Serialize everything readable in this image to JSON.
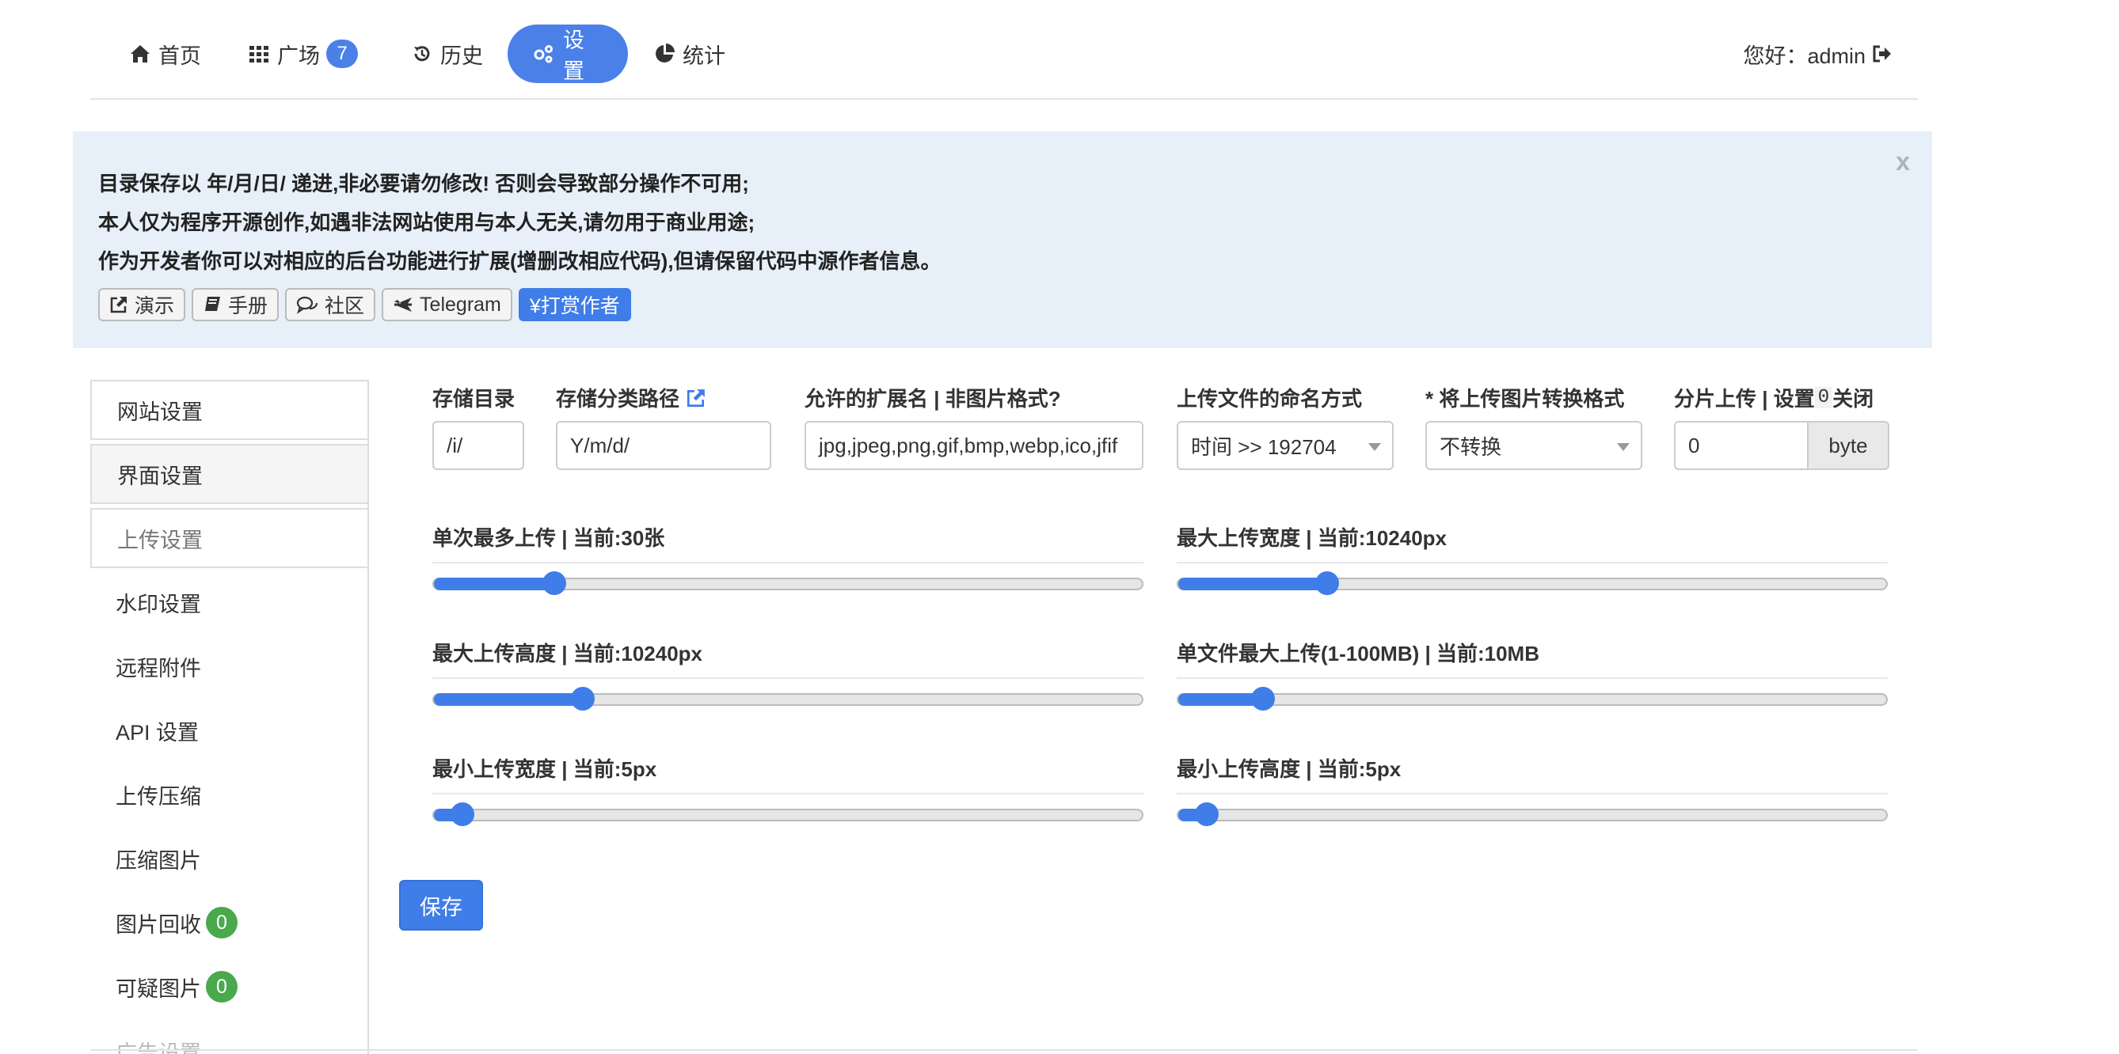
{
  "nav": {
    "home": "首页",
    "square": "广场",
    "square_badge": "7",
    "history": "历史",
    "settings": "设置",
    "stats": "统计",
    "greeting": "您好：admin"
  },
  "notice": {
    "close": "x",
    "line1": "目录保存以 年/月/日/ 递进,非必要请勿修改! 否则会导致部分操作不可用;",
    "line2": "本人仅为程序开源创作,如遇非法网站使用与本人无关,请勿用于商业用途;",
    "line3": "作为开发者你可以对相应的后台功能进行扩展(增删改相应代码),但请保留代码中源作者信息。",
    "buttons": {
      "demo": "演示",
      "manual": "手册",
      "community": "社区",
      "telegram": "Telegram",
      "donate": "¥打赏作者"
    }
  },
  "sidebar": {
    "items": [
      {
        "label": "网站设置"
      },
      {
        "label": "界面设置"
      },
      {
        "label": "上传设置"
      },
      {
        "label": "水印设置"
      },
      {
        "label": "远程附件"
      },
      {
        "label": "API 设置"
      },
      {
        "label": "上传压缩"
      },
      {
        "label": "压缩图片"
      },
      {
        "label": "图片回收",
        "badge": "0"
      },
      {
        "label": "可疑图片",
        "badge": "0"
      },
      {
        "label": "广告设置"
      }
    ]
  },
  "form": {
    "storage_dir": {
      "label": "存储目录",
      "value": "/i/"
    },
    "storage_path": {
      "label": "存储分类路径",
      "value": "Y/m/d/"
    },
    "extensions": {
      "label": "允许的扩展名 | 非图片格式?",
      "value": "jpg,jpeg,png,gif,bmp,webp,ico,jfif"
    },
    "naming": {
      "label": "上传文件的命名方式",
      "value": "时间 >> 192704"
    },
    "convert": {
      "label": "* 将上传图片转换格式",
      "value": "不转换"
    },
    "chunk": {
      "label_pre": "分片上传 | 设置",
      "label_code": "0",
      "label_post": "关闭",
      "value": "0",
      "unit": "byte"
    }
  },
  "sliders": [
    {
      "label": "单次最多上传 | 当前:30张",
      "fraction": 0.17
    },
    {
      "label": "最大上传宽度 | 当前:10240px",
      "fraction": 0.21
    },
    {
      "label": "最大上传高度 | 当前:10240px",
      "fraction": 0.21
    },
    {
      "label": "单文件最大上传(1-100MB) | 当前:10MB",
      "fraction": 0.12
    },
    {
      "label": "最小上传宽度 | 当前:5px",
      "fraction": 0.04
    },
    {
      "label": "最小上传高度 | 当前:5px",
      "fraction": 0.04
    }
  ],
  "save_label": "保存",
  "colors": {
    "accent": "#3f7de8",
    "badge_green": "#4aa84d",
    "notice_bg": "#e7f0f8"
  }
}
